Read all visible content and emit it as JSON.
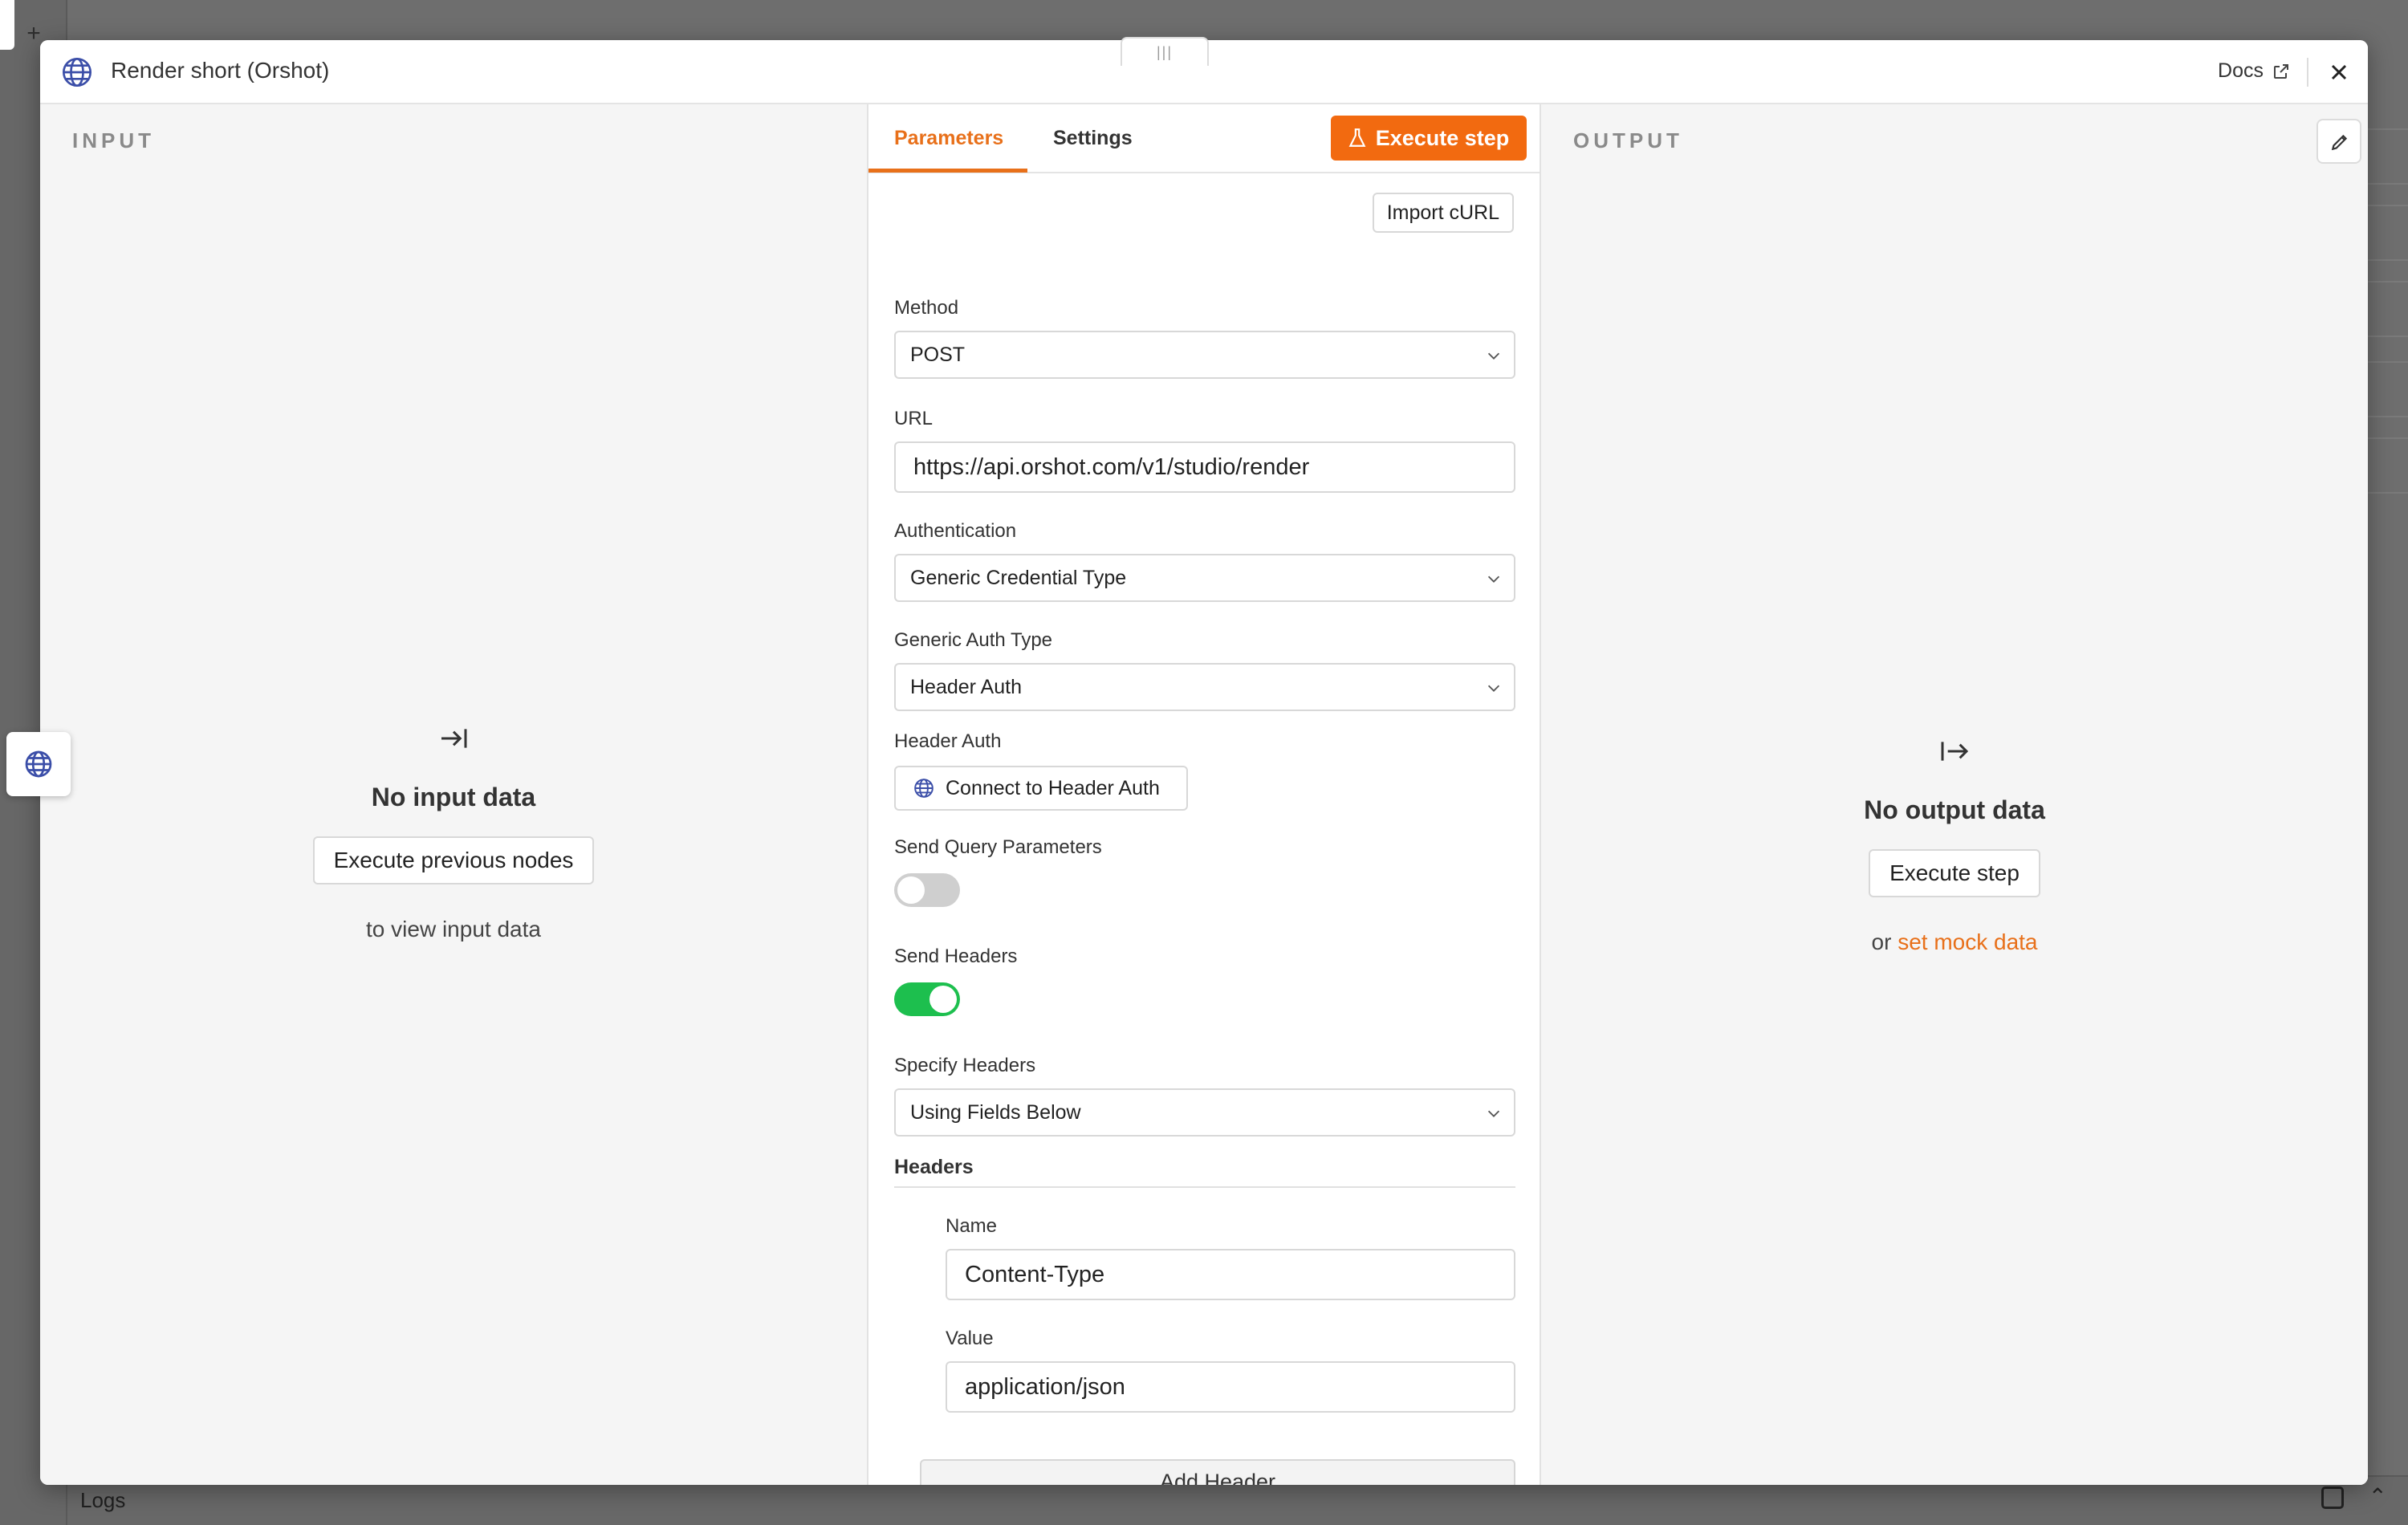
{
  "app": {
    "logs_label": "Logs"
  },
  "modal": {
    "title": "Render short (Orshot)",
    "docs_label": "Docs",
    "icon": "globe-icon"
  },
  "input_panel": {
    "heading": "INPUT",
    "empty_title": "No input data",
    "button_label": "Execute previous nodes",
    "note": "to view input data"
  },
  "output_panel": {
    "heading": "OUTPUT",
    "empty_title": "No output data",
    "button_label": "Execute step",
    "note_prefix": "or",
    "note_link": "set mock data"
  },
  "center": {
    "tabs": [
      {
        "label": "Parameters",
        "active": true
      },
      {
        "label": "Settings",
        "active": false
      }
    ],
    "execute_label": "Execute step",
    "import_label": "Import cURL",
    "fields": {
      "method": {
        "label": "Method",
        "value": "POST"
      },
      "url": {
        "label": "URL",
        "value": "https://api.orshot.com/v1/studio/render"
      },
      "authentication": {
        "label": "Authentication",
        "value": "Generic Credential Type"
      },
      "generic_auth_type": {
        "label": "Generic Auth Type",
        "value": "Header Auth"
      },
      "header_auth": {
        "label": "Header Auth",
        "button": "Connect to Header Auth"
      },
      "send_query": {
        "label": "Send Query Parameters",
        "enabled": false
      },
      "send_headers": {
        "label": "Send Headers",
        "enabled": true
      },
      "specify_headers": {
        "label": "Specify Headers",
        "value": "Using Fields Below"
      }
    },
    "headers": {
      "title": "Headers",
      "name_label": "Name",
      "name_value": "Content-Type",
      "value_label": "Value",
      "value_value": "application/json",
      "add_label": "Add Header"
    }
  },
  "colors": {
    "accent": "#f26a10",
    "toggle_on": "#1dbf4e",
    "globe": "#3b4ea8"
  }
}
